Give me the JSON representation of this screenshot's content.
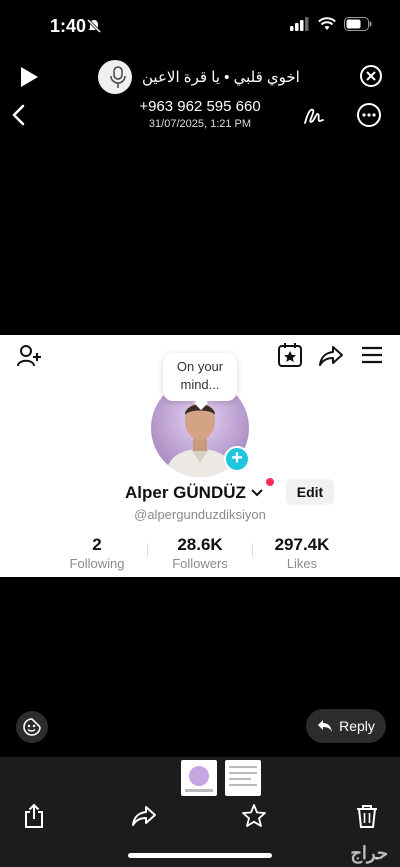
{
  "status": {
    "time": "1:40"
  },
  "audio": {
    "title": "اخوي قلبي • يا قرة الاعين"
  },
  "chat": {
    "phone": "+963 962 595 660",
    "timestamp": "31/07/2025, 1:21 PM"
  },
  "profile": {
    "bubble": "On your mind...",
    "name": "Alper  GÜNDÜZ",
    "handle": "@alpergunduzdiksiyon",
    "edit_label": "Edit",
    "stats": [
      {
        "value": "2",
        "label": "Following"
      },
      {
        "value": "28.6K",
        "label": "Followers"
      },
      {
        "value": "297.4K",
        "label": "Likes"
      }
    ]
  },
  "reply_label": "Reply",
  "watermark": "حراج",
  "icons": [
    "silent-bell-icon",
    "cellular-icon",
    "wifi-icon",
    "battery-icon",
    "play-icon",
    "microphone-icon",
    "close-circle-icon",
    "back-chevron-icon",
    "markup-icon",
    "more-icon",
    "add-friend-icon",
    "favorites-icon",
    "share-arrow-icon",
    "menu-icon",
    "chevron-down-icon",
    "sticker-icon",
    "reply-arrow-icon",
    "share-icon",
    "forward-icon",
    "star-icon",
    "trash-icon"
  ],
  "colors": {
    "accent_cyan": "#20c6e0",
    "accent_red": "#fe2c55",
    "panel": "#1c1c1e"
  }
}
